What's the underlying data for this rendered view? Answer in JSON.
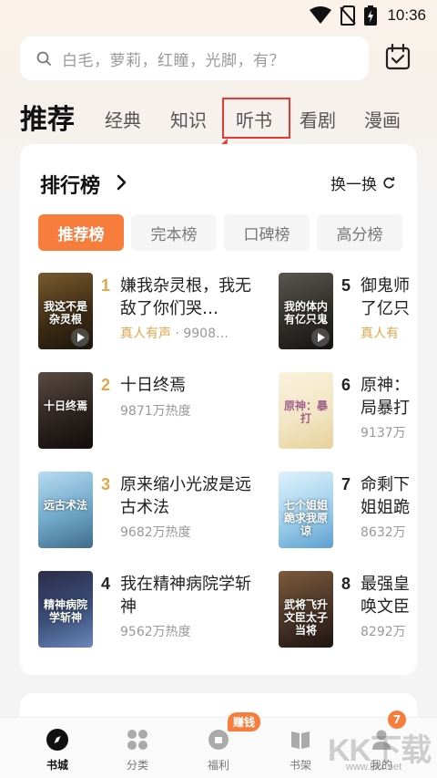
{
  "status_bar": {
    "time": "10:36"
  },
  "search": {
    "placeholder": "白毛，萝莉，红瞳，光脚，有？"
  },
  "tabs": [
    {
      "label": "推荐",
      "active": true
    },
    {
      "label": "经典"
    },
    {
      "label": "知识"
    },
    {
      "label": "听书"
    },
    {
      "label": "看剧"
    },
    {
      "label": "漫画"
    }
  ],
  "ranking": {
    "title": "排行榜",
    "refresh_label": "换一换",
    "chips": [
      {
        "label": "推荐榜",
        "active": true
      },
      {
        "label": "完本榜"
      },
      {
        "label": "口碑榜"
      },
      {
        "label": "高分榜"
      }
    ],
    "books": [
      {
        "rank": "1",
        "title": "嫌我杂灵根，我无敌了你们哭…",
        "tag": "真人有声",
        "meta": " · 9908…",
        "cover_text": "我这不是杂灵根",
        "cover_color": "#4a3a22"
      },
      {
        "rank": "2",
        "title": "十日终焉",
        "meta": "9871万热度",
        "cover_text": "十日终焉",
        "cover_color": "#3a2f2a"
      },
      {
        "rank": "3",
        "title": "原来缩小光波是远古术法",
        "meta": "9682万热度",
        "cover_text": "远古术法",
        "cover_color": "#6fa7c9"
      },
      {
        "rank": "4",
        "title": "我在精神病院学斩神",
        "meta": "9562万热度",
        "cover_text": "精神病院学斩神",
        "cover_color": "#3b4f7a"
      },
      {
        "rank": "5",
        "title": "御鬼师了亿只",
        "tag": "真人有",
        "cover_text": "我的体内有亿只鬼",
        "cover_color": "#3c3a38"
      },
      {
        "rank": "6",
        "title": "原神：局暴打",
        "meta": "9137万",
        "cover_text": "原神：暴打",
        "cover_color": "#f3e6c6"
      },
      {
        "rank": "7",
        "title": "命剩下姐姐跪",
        "meta": "8632万",
        "cover_text": "七个姐姐跪求我原谅",
        "cover_color": "#9fd0ec"
      },
      {
        "rank": "8",
        "title": "最强皇唤文臣",
        "meta": "8292万",
        "cover_text": "武将飞升文臣太子当将",
        "cover_color": "#4a3528"
      }
    ]
  },
  "bottom_nav": [
    {
      "label": "书城",
      "icon": "compass-icon",
      "active": true
    },
    {
      "label": "分类",
      "icon": "grid-icon"
    },
    {
      "label": "福利",
      "icon": "gift-icon",
      "badge": "赚钱"
    },
    {
      "label": "书架",
      "icon": "book-icon"
    },
    {
      "label": "我的",
      "icon": "user-icon",
      "badge": "7"
    }
  ],
  "watermark": {
    "big": "KK下载",
    "small": "www.kkx.net"
  },
  "colors": {
    "accent": "#f77d3c",
    "gold": "#e0a64c",
    "highlight": "#e53935"
  }
}
